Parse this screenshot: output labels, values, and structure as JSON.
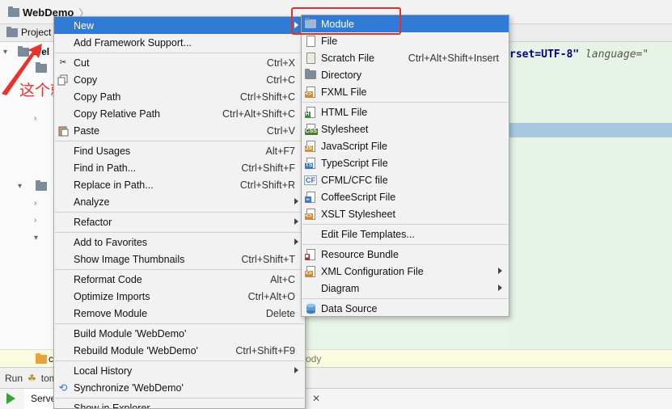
{
  "ide": {
    "project_name": "WebDemo",
    "breadcrumb_chevron": "〉",
    "project_tab": "Project",
    "tree_label_partial": "Wel",
    "editor_code_line": "rset=UTF-8\"",
    "editor_code_lang": "language=\"",
    "code_strip_tag": "ody",
    "code_strip_folder_label": "c",
    "run_label": "Run",
    "run_config": "tom",
    "server_tab": "Serve",
    "close_symbol": "✕"
  },
  "annotation": {
    "text": "这个就是project",
    "color": "#e8322a"
  },
  "context_menu": {
    "items": [
      {
        "label": "New",
        "mnemonic_index": null,
        "shortcut": "",
        "submenu": true,
        "selected": true,
        "icon": ""
      },
      {
        "label": "Add Framework Support...",
        "shortcut": "",
        "submenu": false,
        "icon": ""
      },
      {
        "label": "Cut",
        "shortcut": "Ctrl+X",
        "submenu": false,
        "icon": "scissors-icon"
      },
      {
        "label": "Copy",
        "shortcut": "Ctrl+C",
        "submenu": false,
        "icon": "copy-icon"
      },
      {
        "label": "Copy Path",
        "shortcut": "Ctrl+Shift+C",
        "submenu": false,
        "icon": ""
      },
      {
        "label": "Copy Relative Path",
        "shortcut": "Ctrl+Alt+Shift+C",
        "submenu": false,
        "icon": ""
      },
      {
        "label": "Paste",
        "shortcut": "Ctrl+V",
        "submenu": false,
        "icon": "paste-icon"
      },
      {
        "label": "Find Usages",
        "shortcut": "Alt+F7",
        "submenu": false,
        "icon": ""
      },
      {
        "label": "Find in Path...",
        "shortcut": "Ctrl+Shift+F",
        "submenu": false,
        "icon": ""
      },
      {
        "label": "Replace in Path...",
        "shortcut": "Ctrl+Shift+R",
        "submenu": false,
        "icon": ""
      },
      {
        "label": "Analyze",
        "shortcut": "",
        "submenu": true,
        "icon": ""
      },
      {
        "label": "Refactor",
        "shortcut": "",
        "submenu": true,
        "icon": ""
      },
      {
        "label": "Add to Favorites",
        "shortcut": "",
        "submenu": true,
        "icon": ""
      },
      {
        "label": "Show Image Thumbnails",
        "shortcut": "Ctrl+Shift+T",
        "submenu": false,
        "icon": ""
      },
      {
        "label": "Reformat Code",
        "shortcut": "Alt+C",
        "submenu": false,
        "icon": ""
      },
      {
        "label": "Optimize Imports",
        "shortcut": "Ctrl+Alt+O",
        "submenu": false,
        "icon": ""
      },
      {
        "label": "Remove Module",
        "shortcut": "Delete",
        "submenu": false,
        "icon": ""
      },
      {
        "label": "Build Module 'WebDemo'",
        "shortcut": "",
        "submenu": false,
        "icon": ""
      },
      {
        "label": "Rebuild Module 'WebDemo'",
        "shortcut": "Ctrl+Shift+F9",
        "submenu": false,
        "icon": ""
      },
      {
        "label": "Local History",
        "shortcut": "",
        "submenu": true,
        "icon": ""
      },
      {
        "label": "Synchronize 'WebDemo'",
        "shortcut": "",
        "submenu": false,
        "icon": "sync-icon"
      },
      {
        "label": "Show in Explorer",
        "shortcut": "",
        "submenu": false,
        "icon": ""
      }
    ]
  },
  "new_submenu": {
    "items": [
      {
        "label": "Module",
        "shortcut": "",
        "submenu": false,
        "selected": true,
        "icon": "module-icon"
      },
      {
        "label": "File",
        "shortcut": "",
        "submenu": false,
        "icon": "file-icon"
      },
      {
        "label": "Scratch File",
        "shortcut": "Ctrl+Alt+Shift+Insert",
        "submenu": false,
        "icon": "scratch-file-icon"
      },
      {
        "label": "Directory",
        "shortcut": "",
        "submenu": false,
        "icon": "directory-icon"
      },
      {
        "label": "FXML File",
        "shortcut": "",
        "submenu": false,
        "icon": "fxml-file-icon"
      },
      {
        "label": "HTML File",
        "shortcut": "",
        "submenu": false,
        "icon": "html-file-icon"
      },
      {
        "label": "Stylesheet",
        "shortcut": "",
        "submenu": false,
        "icon": "css-file-icon"
      },
      {
        "label": "JavaScript File",
        "shortcut": "",
        "submenu": false,
        "icon": "js-file-icon"
      },
      {
        "label": "TypeScript File",
        "shortcut": "",
        "submenu": false,
        "icon": "ts-file-icon"
      },
      {
        "label": "CFML/CFC file",
        "shortcut": "",
        "submenu": false,
        "icon": "cf-file-icon"
      },
      {
        "label": "CoffeeScript File",
        "shortcut": "",
        "submenu": false,
        "icon": "coffeescript-file-icon"
      },
      {
        "label": "XSLT Stylesheet",
        "shortcut": "",
        "submenu": false,
        "icon": "xslt-file-icon"
      },
      {
        "label": "Edit File Templates...",
        "shortcut": "",
        "submenu": false,
        "icon": ""
      },
      {
        "label": "Resource Bundle",
        "shortcut": "",
        "submenu": false,
        "icon": "resource-bundle-icon"
      },
      {
        "label": "XML Configuration File",
        "shortcut": "",
        "submenu": true,
        "icon": "xml-file-icon"
      },
      {
        "label": "Diagram",
        "shortcut": "",
        "submenu": true,
        "icon": ""
      },
      {
        "label": "Data Source",
        "shortcut": "",
        "submenu": false,
        "icon": "database-icon"
      }
    ]
  },
  "colors": {
    "selection": "#2f7bd6",
    "highlight_box": "#e0302a"
  }
}
